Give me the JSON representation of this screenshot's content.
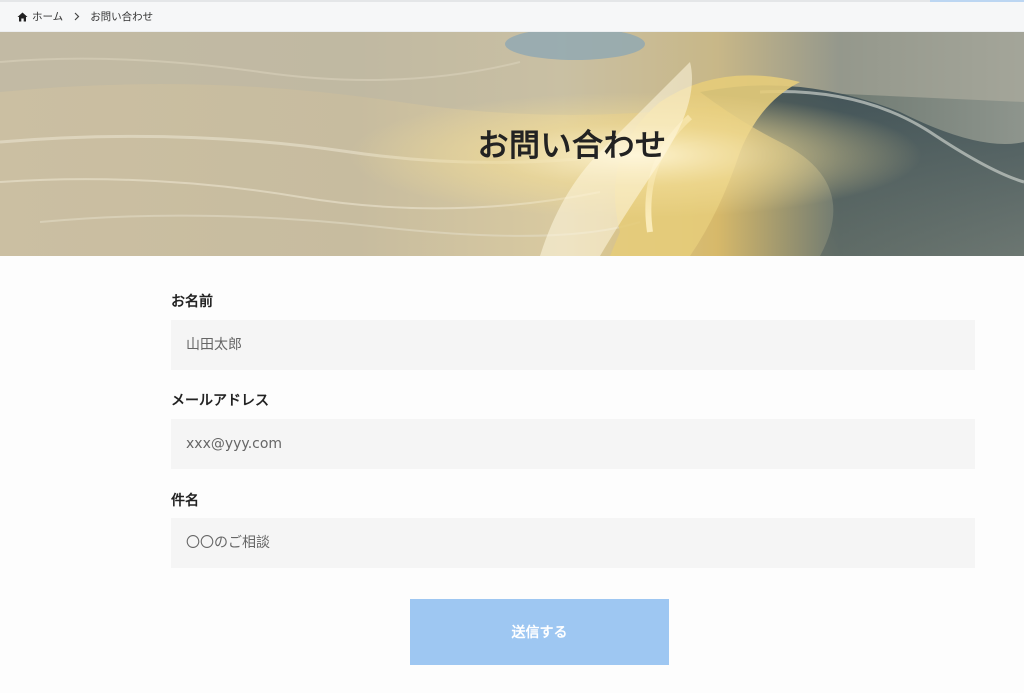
{
  "breadcrumb": {
    "home_icon": "home-icon",
    "home_label": "ホーム",
    "separator_icon": "chevron-right-icon",
    "current": "お問い合わせ"
  },
  "hero": {
    "title": "お問い合わせ",
    "background": "ocean-wave-photo"
  },
  "form": {
    "fields": [
      {
        "label": "お名前",
        "placeholder": "山田太郎",
        "value": ""
      },
      {
        "label": "メールアドレス",
        "placeholder": "xxx@yyy.com",
        "value": ""
      },
      {
        "label": "件名",
        "placeholder": "〇〇のご相談",
        "value": ""
      }
    ],
    "submit_label": "送信する"
  },
  "colors": {
    "submit_button": "#9ec7f2",
    "input_background": "#f5f5f5",
    "breadcrumb_background": "#f6f7f8"
  }
}
